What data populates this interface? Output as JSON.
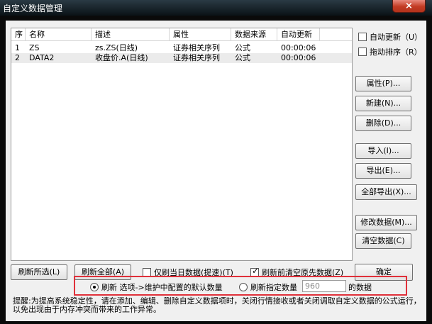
{
  "window": {
    "title": "自定义数据管理",
    "close_label": "×"
  },
  "table": {
    "columns": [
      "序",
      "名称",
      "描述",
      "属性",
      "数据来源",
      "自动更新"
    ],
    "rows": [
      {
        "seq": "1",
        "name": "ZS",
        "desc": "zs.ZS(日线)",
        "attr": "证券相关序列",
        "source": "公式",
        "update": "00:00:06"
      },
      {
        "seq": "2",
        "name": "DATA2",
        "desc": "收盘价.A(日线)",
        "attr": "证券相关序列",
        "source": "公式",
        "update": "00:00:06"
      }
    ]
  },
  "options": {
    "auto_update": "自动更新（U）",
    "drag_sort": "拖动排序（R）"
  },
  "buttons": {
    "properties": "属性(P)...",
    "new": "新建(N)...",
    "delete": "删除(D)...",
    "import": "导入(I)...",
    "export": "导出(E)...",
    "export_all": "全部导出(X)...",
    "modify_data": "修改数据(M)...",
    "clear_data": "清空数据(C)",
    "refresh_selected": "刷新所选(L)",
    "refresh_all": "刷新全部(A)",
    "ok": "确定"
  },
  "refresh": {
    "only_today": "仅刷当日数据(提速)(T)",
    "clear_before": "刷新前清空原先数据(Z)",
    "mode_default": "刷新 选项->维护中配置的默认数量",
    "mode_specified": "刷新指定数量",
    "count_value": "960",
    "count_suffix": "的数据"
  },
  "hint": "提醒:为提高系统稳定性，请在添加、编辑、删除自定义数据项时，关闭行情接收或者关闭调取自定义数据的公式运行，以免出现由于内存冲突而带来的工作异常。"
}
